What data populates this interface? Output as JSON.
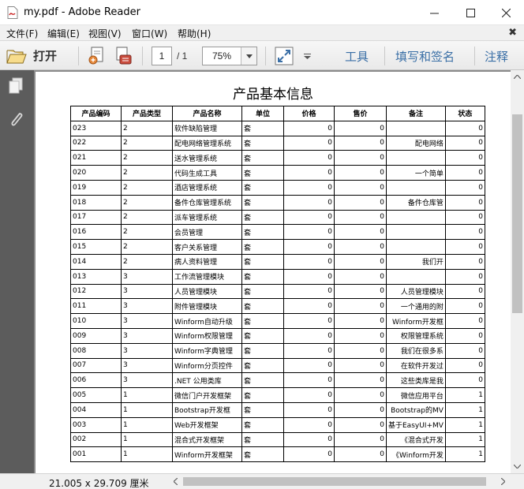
{
  "window": {
    "title": "my.pdf - Adobe Reader",
    "minimize_glyph": "—",
    "maximize_glyph": "☐",
    "close_glyph": "✕"
  },
  "menu": {
    "items": [
      "文件(F)",
      "编辑(E)",
      "视图(V)",
      "窗口(W)",
      "帮助(H)"
    ],
    "close_glyph": "✖"
  },
  "toolbar": {
    "open_label": "打开",
    "page_current": "1",
    "page_total": "/ 1",
    "zoom": "75%",
    "tools_label": "工具",
    "fill_sign_label": "填写和签名",
    "comment_label": "注释"
  },
  "document": {
    "title": "产品基本信息",
    "columns": [
      "产品编码",
      "产品类型",
      "产品名称",
      "单位",
      "价格",
      "售价",
      "备注",
      "状态"
    ],
    "rows": [
      [
        "023",
        "2",
        "软件缺陷管理",
        "套",
        "0",
        "0",
        "",
        "0"
      ],
      [
        "022",
        "2",
        "配电网络管理系统",
        "套",
        "0",
        "0",
        "配电网络",
        "0"
      ],
      [
        "021",
        "2",
        "送水管理系统",
        "套",
        "0",
        "0",
        "",
        "0"
      ],
      [
        "020",
        "2",
        "代码生成工具",
        "套",
        "0",
        "0",
        "一个简单",
        "0"
      ],
      [
        "019",
        "2",
        "酒店管理系统",
        "套",
        "0",
        "0",
        "",
        "0"
      ],
      [
        "018",
        "2",
        "备件仓库管理系统",
        "套",
        "0",
        "0",
        "备件仓库管",
        "0"
      ],
      [
        "017",
        "2",
        "派车管理系统",
        "套",
        "0",
        "0",
        "",
        "0"
      ],
      [
        "016",
        "2",
        "会员管理",
        "套",
        "0",
        "0",
        "",
        "0"
      ],
      [
        "015",
        "2",
        "客户关系管理",
        "套",
        "0",
        "0",
        "",
        "0"
      ],
      [
        "014",
        "2",
        "病人资料管理",
        "套",
        "0",
        "0",
        "我们开",
        "0"
      ],
      [
        "013",
        "3",
        "工作流管理模块",
        "套",
        "0",
        "0",
        "",
        "0"
      ],
      [
        "012",
        "3",
        "人员管理模块",
        "套",
        "0",
        "0",
        "人员管理模块",
        "0"
      ],
      [
        "011",
        "3",
        "附件管理模块",
        "套",
        "0",
        "0",
        "一个通用的附",
        "0"
      ],
      [
        "010",
        "3",
        "Winform自动升级",
        "套",
        "0",
        "0",
        "Winform开发框",
        "0"
      ],
      [
        "009",
        "3",
        "Winform权限管理",
        "套",
        "0",
        "0",
        "权限管理系统",
        "0"
      ],
      [
        "008",
        "3",
        "Winform字典管理",
        "套",
        "0",
        "0",
        "我们在很多系",
        "0"
      ],
      [
        "007",
        "3",
        "Winform分页控件",
        "套",
        "0",
        "0",
        "在软件开发过",
        "0"
      ],
      [
        "006",
        "3",
        ".NET 公用类库",
        "套",
        "0",
        "0",
        "这些类库是我",
        "0"
      ],
      [
        "005",
        "1",
        "微信门户开发框架",
        "套",
        "0",
        "0",
        "微信应用平台",
        "1"
      ],
      [
        "004",
        "1",
        "Bootstrap开发框",
        "套",
        "0",
        "0",
        "Bootstrap的MV",
        "1"
      ],
      [
        "003",
        "1",
        "Web开发框架",
        "套",
        "0",
        "0",
        "基于EasyUI+MV",
        "1"
      ],
      [
        "002",
        "1",
        "混合式开发框架",
        "套",
        "0",
        "0",
        "《混合式开发",
        "1"
      ],
      [
        "001",
        "1",
        "Winform开发框架",
        "套",
        "0",
        "0",
        "《Winform开发",
        "1"
      ]
    ]
  },
  "statusbar": {
    "page_size": "21.005 x 29.709 厘米"
  },
  "icons": {
    "app": "pdf-file-icon",
    "open": "folder-open-icon",
    "nav_pages": "page-thumbnails-icon",
    "nav_attach": "paperclip-icon"
  },
  "colors": {
    "accent_text": "#3a6fa6",
    "nav_pane": "#5c5c5c",
    "doc_background": "#8a8a8a"
  }
}
